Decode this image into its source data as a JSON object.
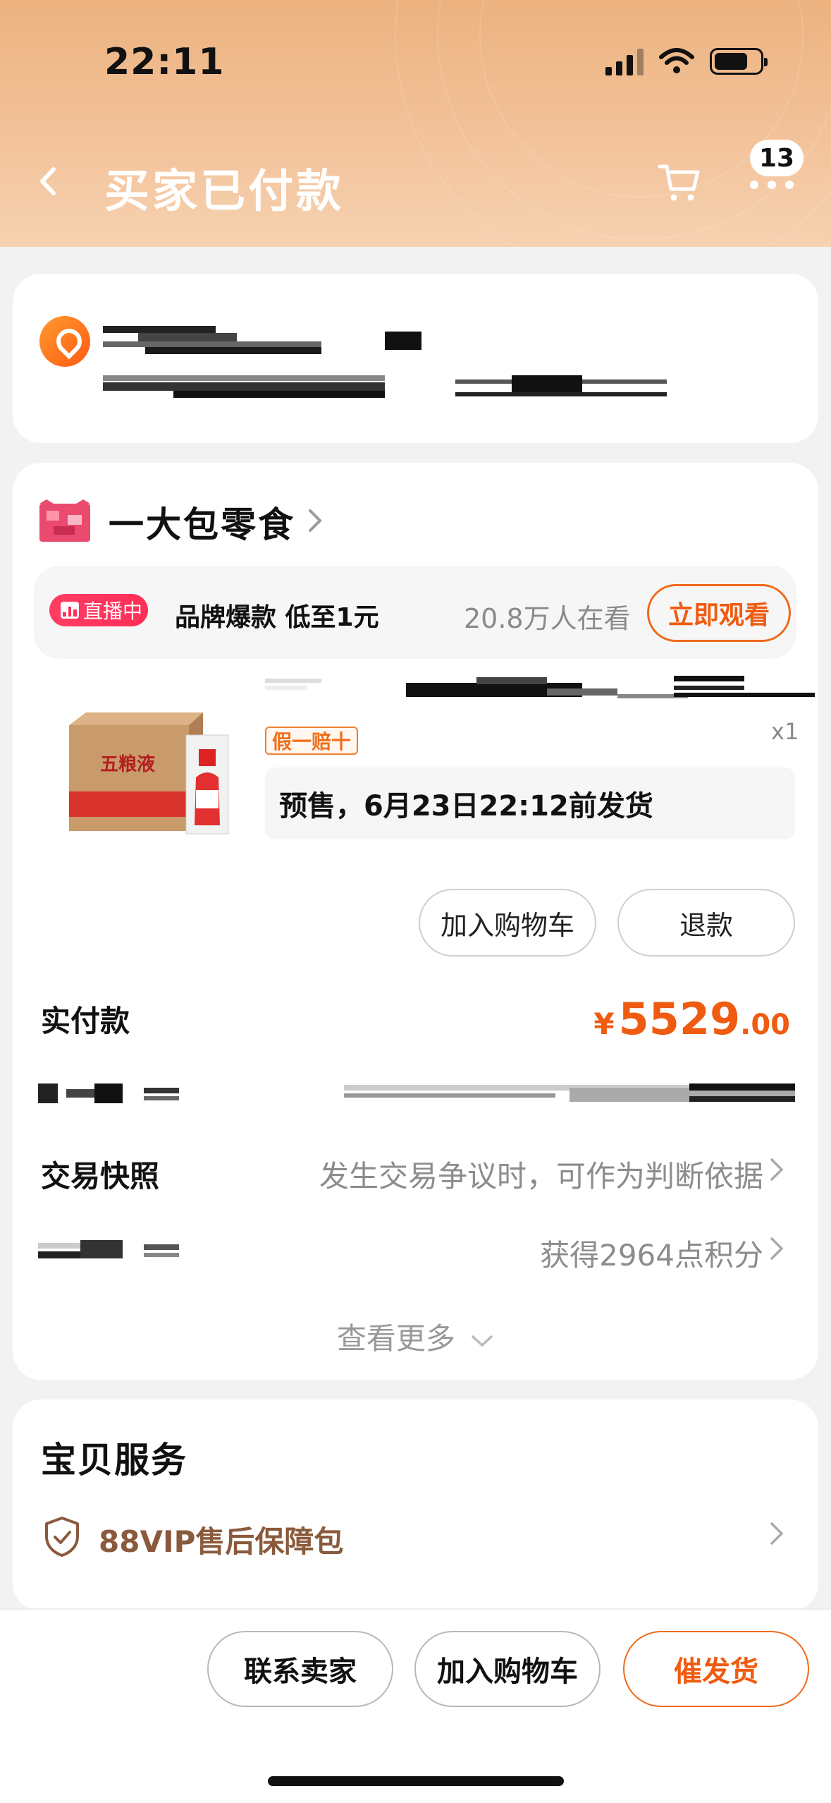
{
  "status_bar": {
    "time": "22:11"
  },
  "header": {
    "title": "买家已付款",
    "more_badge": "13"
  },
  "store": {
    "name": "一大包零食"
  },
  "live": {
    "badge": "直播中",
    "promo": "品牌爆款 低至1元",
    "viewers": "20.8万人在看",
    "watch_label": "立即观看"
  },
  "product": {
    "tag": "假一赔十",
    "quantity": "x1",
    "presale_note": "预售，6月23日22:12前发货",
    "add_cart_label": "加入购物车",
    "refund_label": "退款"
  },
  "payment": {
    "label": "实付款",
    "currency": "¥",
    "amount_int": "5529",
    "amount_dec": ".00"
  },
  "snapshot": {
    "label": "交易快照",
    "value": "发生交易争议时，可作为判断依据"
  },
  "points": {
    "value": "获得2964点积分"
  },
  "see_more": "查看更多",
  "service": {
    "title": "宝贝服务",
    "item": "88VIP售后保障包"
  },
  "bottom_bar": {
    "contact": "联系卖家",
    "add_cart": "加入购物车",
    "urge": "催发货"
  },
  "colors": {
    "accent": "#ef5b10",
    "header_bg": "#ecb27f",
    "live_red": "#ff2e57"
  }
}
